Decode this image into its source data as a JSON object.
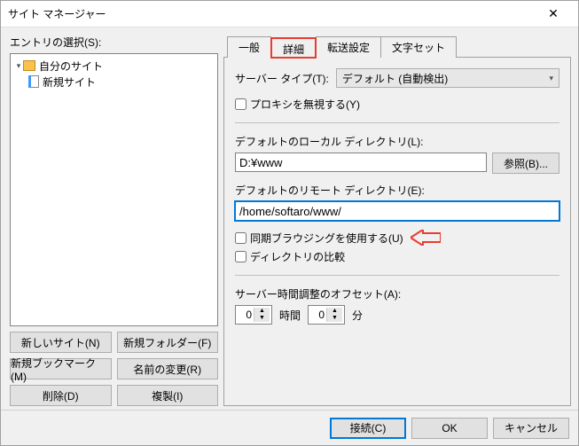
{
  "title": "サイト マネージャー",
  "left": {
    "label": "エントリの選択(S):",
    "root": "自分のサイト",
    "item": "新規サイト",
    "buttons": {
      "newSite": "新しいサイト(N)",
      "newFolder": "新規フォルダー(F)",
      "newBookmark": "新規ブックマーク(M)",
      "rename": "名前の変更(R)",
      "delete": "削除(D)",
      "duplicate": "複製(I)"
    }
  },
  "tabs": {
    "general": "一般",
    "advanced": "詳細",
    "transfer": "転送設定",
    "charset": "文字セット"
  },
  "panel": {
    "serverTypeLabel": "サーバー タイプ(T):",
    "serverTypeValue": "デフォルト (自動検出)",
    "bypassProxy": "プロキシを無視する(Y)",
    "localDirLabel": "デフォルトのローカル ディレクトリ(L):",
    "localDirValue": "D:¥www",
    "browse": "参照(B)...",
    "remoteDirLabel": "デフォルトのリモート ディレクトリ(E):",
    "remoteDirValue": "/home/softaro/www/",
    "syncBrowse": "同期ブラウジングを使用する(U)",
    "dirCompare": "ディレクトリの比較",
    "offsetLabel": "サーバー時間調整のオフセット(A):",
    "hours": "0",
    "hoursUnit": "時間",
    "minutes": "0",
    "minutesUnit": "分"
  },
  "footer": {
    "connect": "接続(C)",
    "ok": "OK",
    "cancel": "キャンセル"
  }
}
